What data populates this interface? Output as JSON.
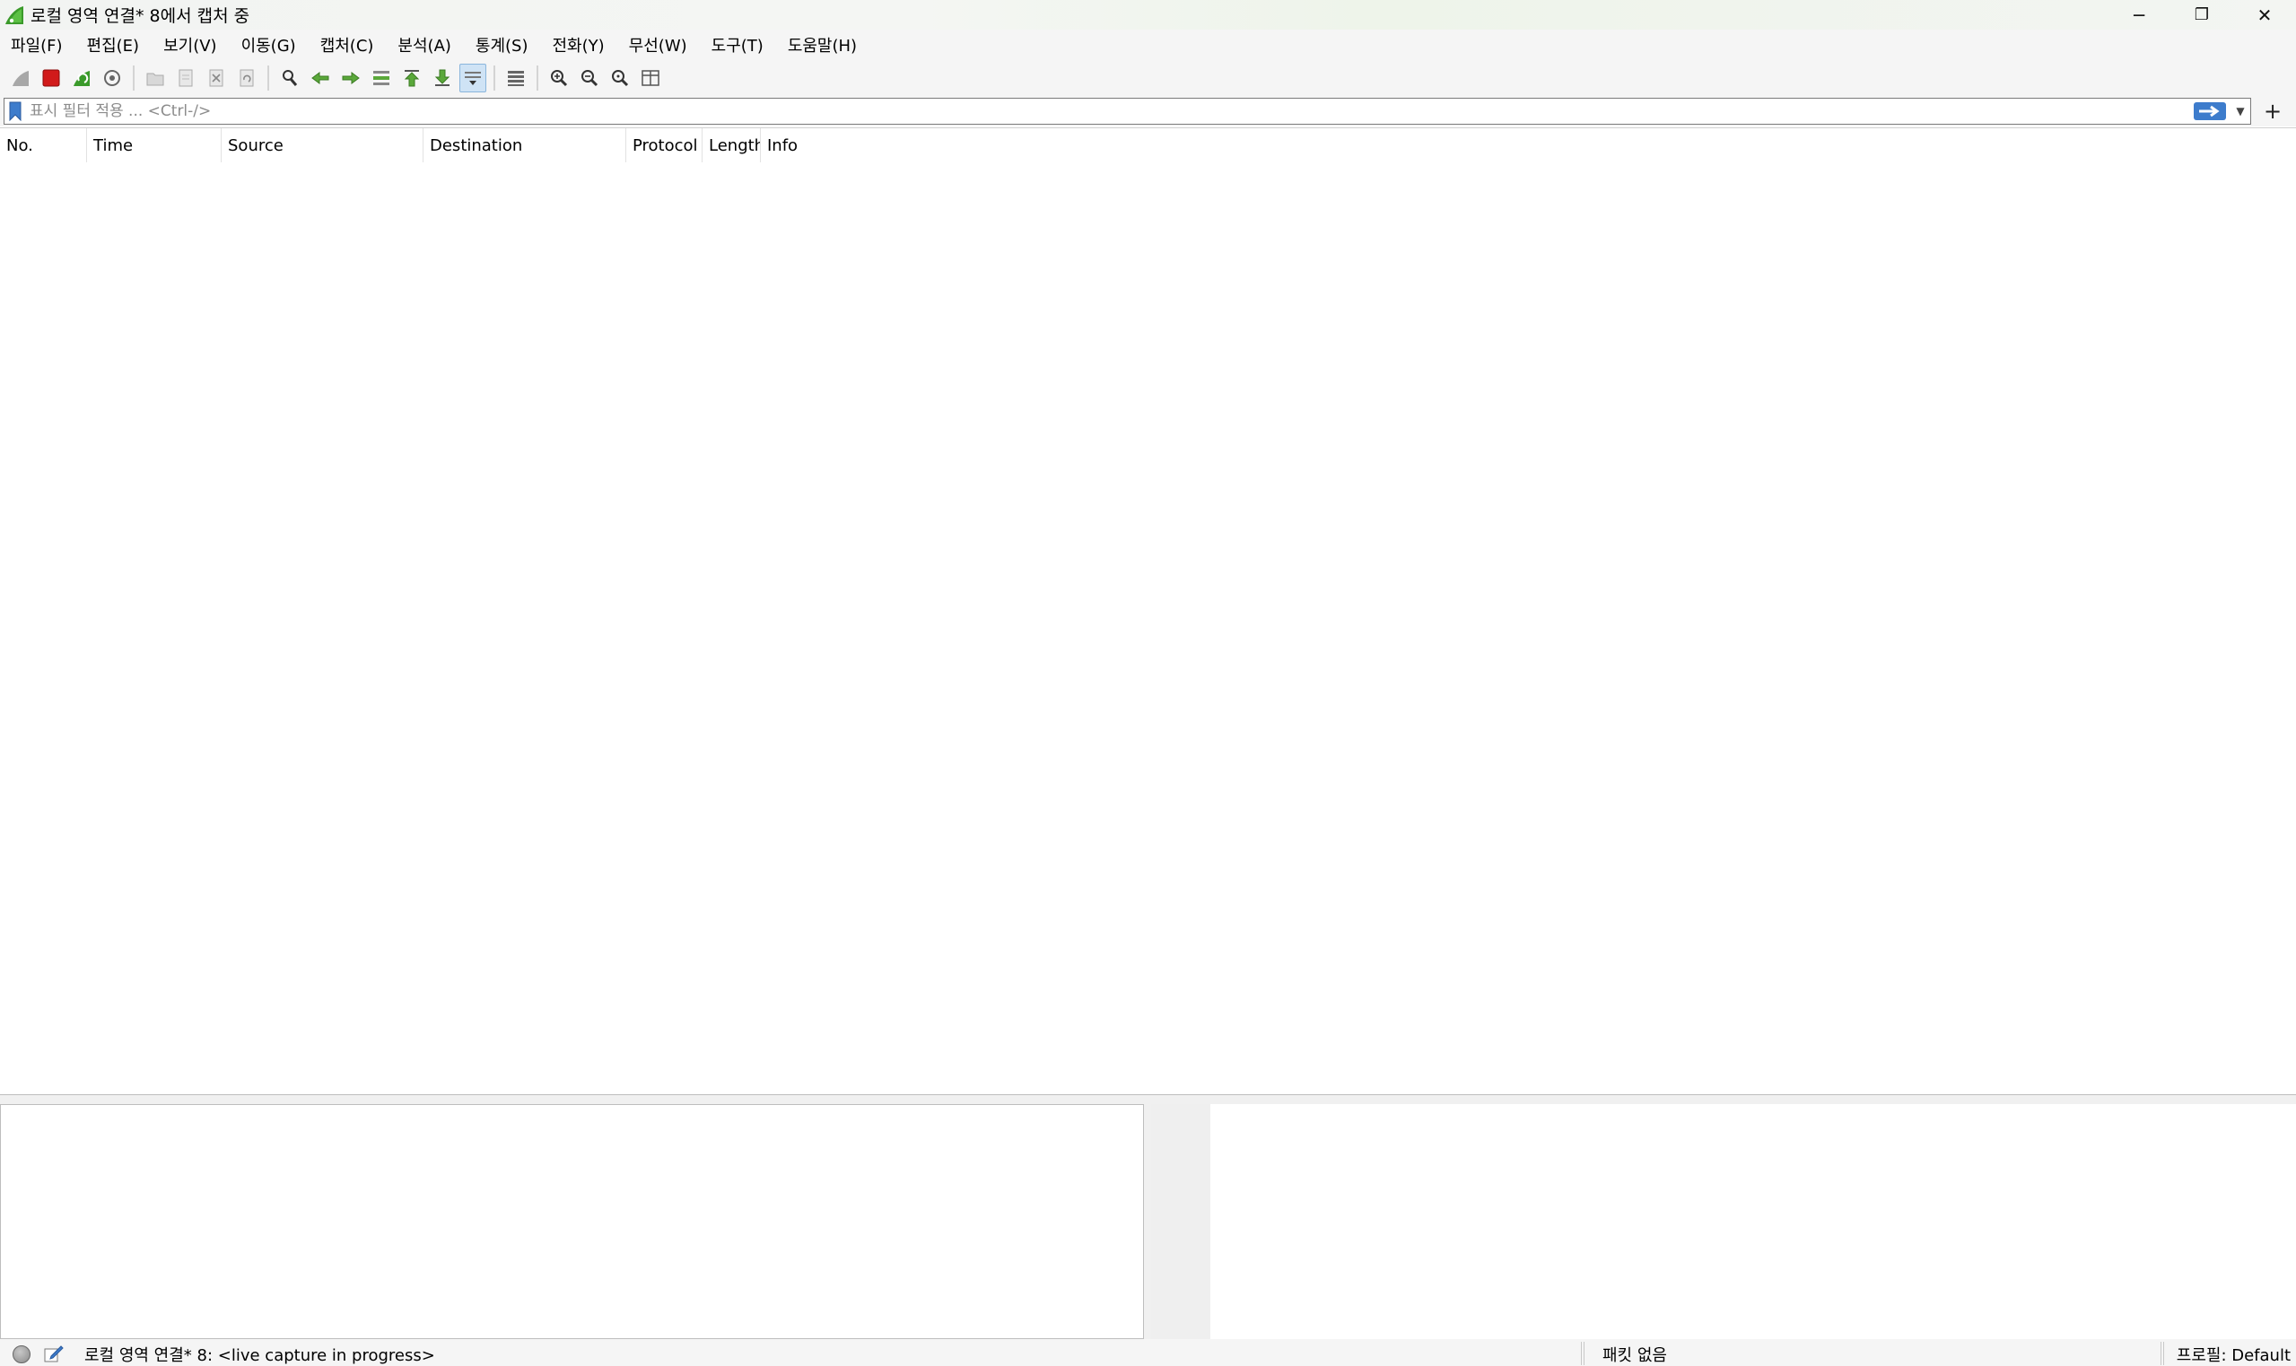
{
  "window": {
    "title": "로컬 영역 연결* 8에서 캡처 중",
    "minimize": "─",
    "restore": "❐",
    "close": "✕"
  },
  "menu": [
    {
      "label": "파일(F)"
    },
    {
      "label": "편집(E)"
    },
    {
      "label": "보기(V)"
    },
    {
      "label": "이동(G)"
    },
    {
      "label": "캡처(C)"
    },
    {
      "label": "분석(A)"
    },
    {
      "label": "통계(S)"
    },
    {
      "label": "전화(Y)"
    },
    {
      "label": "무선(W)"
    },
    {
      "label": "도구(T)"
    },
    {
      "label": "도움말(H)"
    }
  ],
  "toolbar": {
    "icons": [
      "shark-fin-icon",
      "stop-capture-icon",
      "restart-capture-icon",
      "capture-options-icon",
      "open-file-icon",
      "save-file-icon",
      "close-file-icon",
      "reload-file-icon",
      "find-packet-icon",
      "go-back-icon",
      "go-forward-icon",
      "go-to-packet-icon",
      "first-packet-icon",
      "last-packet-icon",
      "autoscroll-icon",
      "colorize-icon",
      "zoom-in-icon",
      "zoom-out-icon",
      "normal-size-icon",
      "resize-columns-icon"
    ]
  },
  "filter": {
    "placeholder": "표시 필터 적용 ... <Ctrl-/>",
    "value": "",
    "add_label": "+"
  },
  "packet_list": {
    "columns": [
      {
        "label": "No."
      },
      {
        "label": "Time"
      },
      {
        "label": "Source"
      },
      {
        "label": "Destination"
      },
      {
        "label": "Protocol"
      },
      {
        "label": "Length"
      },
      {
        "label": "Info"
      }
    ],
    "rows": []
  },
  "status": {
    "interface_text": "로컬 영역 연결* 8: <live capture in progress>",
    "packets_text": "패킷 없음",
    "profile_text": "프로필: Default"
  },
  "colors": {
    "accent_green": "#3a9a2a",
    "stop_red": "#d11a1a",
    "apply_blue": "#3d7ccc"
  }
}
